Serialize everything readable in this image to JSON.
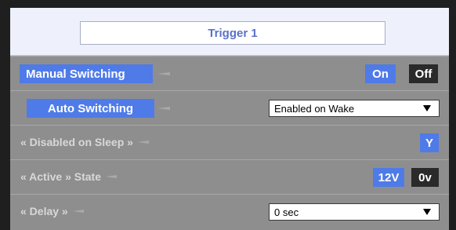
{
  "header": {
    "title": "Trigger 1"
  },
  "rows": [
    {
      "label": "Manual Switching",
      "on_label": "On",
      "off_label": "Off"
    },
    {
      "label": "Auto Switching",
      "select_value": "Enabled on Wake"
    },
    {
      "label": "« Disabled on Sleep »",
      "toggle_label": "Y"
    },
    {
      "label": "« Active » State",
      "on_label": "12V",
      "off_label": "0v"
    },
    {
      "label": "« Delay »",
      "select_value": "0 sec"
    }
  ],
  "icons": {
    "arrow": "arrow-left-icon",
    "caret": "caret-down-icon"
  },
  "colors": {
    "accent": "#4f7be8",
    "dark_toggle": "#2a2a2a",
    "panel_bg": "#8e8e8e",
    "header_bg": "#eef0fb"
  }
}
